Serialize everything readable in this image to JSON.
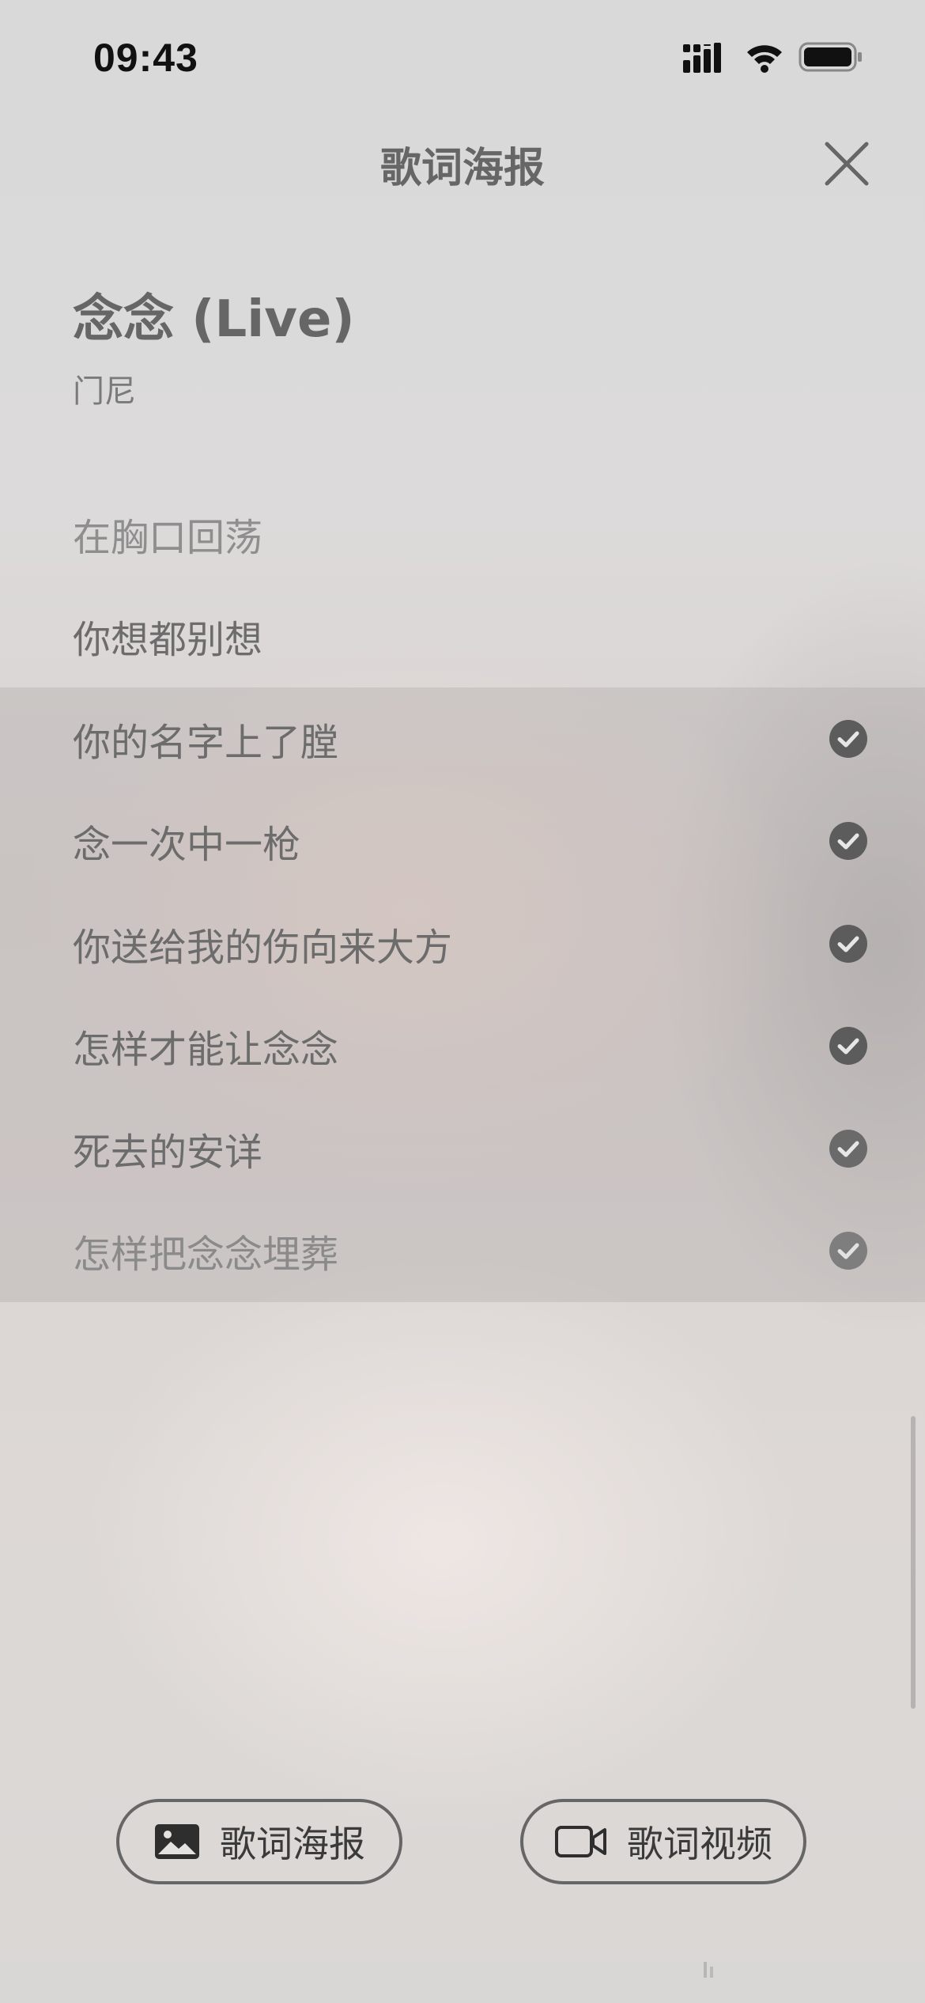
{
  "status_bar": {
    "time": "09:43",
    "icons": [
      "signal-icon",
      "wifi-icon",
      "battery-icon"
    ]
  },
  "header": {
    "title": "歌词海报",
    "close_icon": "close-icon"
  },
  "song": {
    "title": "念念 (Live)",
    "artist": "门尼"
  },
  "lyrics": [
    {
      "text": "在胸口回荡",
      "selected": false
    },
    {
      "text": "你想都别想",
      "selected": false
    },
    {
      "text": "你的名字上了膛",
      "selected": true
    },
    {
      "text": "念一次中一枪",
      "selected": true
    },
    {
      "text": "你送给我的伤向来大方",
      "selected": true
    },
    {
      "text": "怎样才能让念念",
      "selected": true
    },
    {
      "text": "死去的安详",
      "selected": true
    },
    {
      "text": "怎样把念念埋葬",
      "selected": true
    }
  ],
  "actions": {
    "poster_label": "歌词海报",
    "poster_icon": "image-icon",
    "video_label": "歌词视频",
    "video_icon": "video-camera-icon"
  },
  "colors": {
    "check_fill": "#5c5c5c",
    "selected_band": "#a09c9c"
  }
}
